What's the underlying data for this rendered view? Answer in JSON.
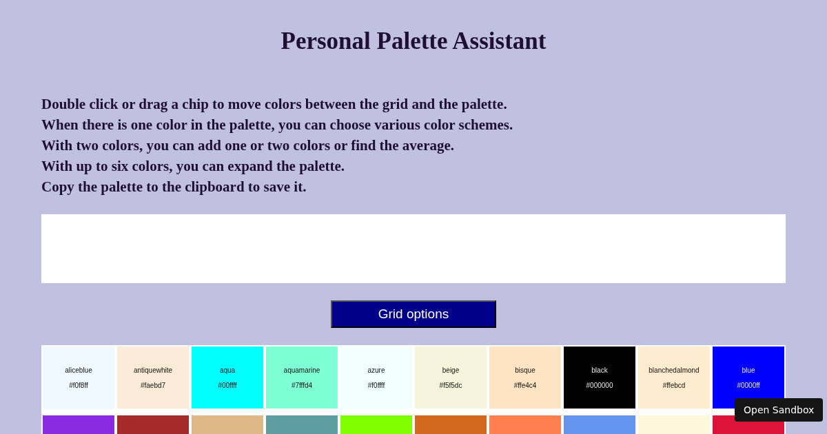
{
  "title": "Personal Palette Assistant",
  "instructions": [
    "Double click or drag a chip to move colors between the grid and the palette.",
    "When there is one color in the palette, you can choose various color schemes.",
    "With two colors, you can add one or two colors or find the average.",
    "With up to six colors, you can expand the palette.",
    "Copy the palette to the clipboard to save it."
  ],
  "grid_options_button": "Grid options",
  "chips": [
    {
      "name": "aliceblue",
      "hex": "#f0f8ff",
      "color": "#f0f8ff",
      "light_text": false
    },
    {
      "name": "antiquewhite",
      "hex": "#faebd7",
      "color": "#faebd7",
      "light_text": false
    },
    {
      "name": "aqua",
      "hex": "#00ffff",
      "color": "#00ffff",
      "light_text": false
    },
    {
      "name": "aquamarine",
      "hex": "#7fffd4",
      "color": "#7fffd4",
      "light_text": false
    },
    {
      "name": "azure",
      "hex": "#f0ffff",
      "color": "#f0ffff",
      "light_text": false
    },
    {
      "name": "beige",
      "hex": "#f5f5dc",
      "color": "#f5f5dc",
      "light_text": false
    },
    {
      "name": "bisque",
      "hex": "#ffe4c4",
      "color": "#ffe4c4",
      "light_text": false
    },
    {
      "name": "black",
      "hex": "#000000",
      "color": "#000000",
      "light_text": true
    },
    {
      "name": "blanchedalmond",
      "hex": "#ffebcd",
      "color": "#ffebcd",
      "light_text": false
    },
    {
      "name": "blue",
      "hex": "#0000ff",
      "color": "#0000ff",
      "light_text": true
    },
    {
      "color": "#8a2be2"
    },
    {
      "color": "#a52a2a"
    },
    {
      "color": "#deb887"
    },
    {
      "color": "#5f9ea0"
    },
    {
      "color": "#7fff00"
    },
    {
      "color": "#d2691e"
    },
    {
      "color": "#ff7f50"
    },
    {
      "color": "#6495ed"
    },
    {
      "color": "#fff8dc"
    },
    {
      "color": "#dc143c"
    }
  ],
  "sandbox_button": "Open Sandbox"
}
